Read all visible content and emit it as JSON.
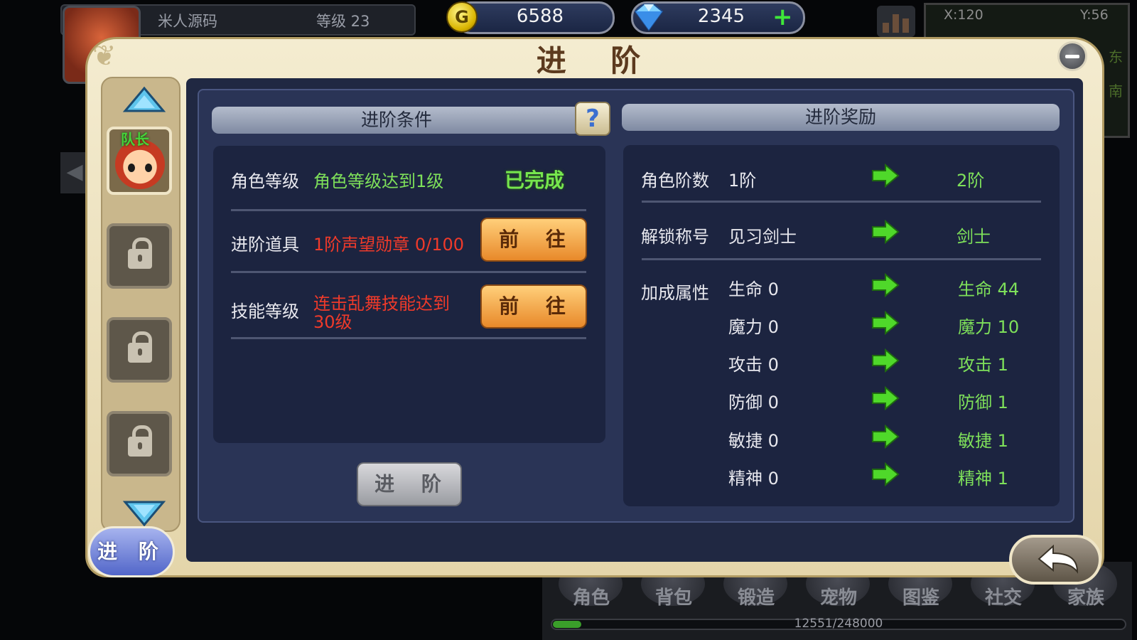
{
  "hud": {
    "player_name": "米人源码",
    "level_text": "等级 23",
    "gold": "6588",
    "gems": "2345",
    "gem_plus": "+",
    "map_x": "X:120",
    "map_y": "Y:56",
    "map_dir_east": "东",
    "map_dir_south": "南"
  },
  "bottom_nav": {
    "items": [
      "角色",
      "背包",
      "锻造",
      "宠物",
      "图鉴",
      "社交",
      "家族"
    ],
    "xp_text": "12551/248000",
    "xp_fraction": 0.05
  },
  "dialog": {
    "title": "进 阶",
    "side_tab_label": "进 阶",
    "leader_label": "队长",
    "conditions_header": "进阶条件",
    "help_label": "?",
    "rewards_header": "进阶奖励",
    "advance_button": "进 阶",
    "conditions": [
      {
        "label": "角色等级",
        "desc": "角色等级达到1级",
        "status": "已完成"
      },
      {
        "label": "进阶道具",
        "desc": "1阶声望勋章  0/100",
        "button": "前 往"
      },
      {
        "label": "技能等级",
        "desc_line1": "连击乱舞技能达到",
        "desc_line2": "30级",
        "button": "前 往"
      }
    ],
    "rewards": {
      "rank": {
        "label": "角色阶数",
        "from": "1阶",
        "to": "2阶"
      },
      "title": {
        "label": "解锁称号",
        "from": "见习剑士",
        "to": "剑士"
      },
      "attrs_label": "加成属性",
      "attrs": [
        {
          "from": "生命 0",
          "to": "生命 44"
        },
        {
          "from": "魔力 0",
          "to": "魔力 10"
        },
        {
          "from": "攻击 0",
          "to": "攻击 1"
        },
        {
          "from": "防御 0",
          "to": "防御 1"
        },
        {
          "from": "敏捷 0",
          "to": "敏捷 1"
        },
        {
          "from": "精神 0",
          "to": "精神 1"
        }
      ]
    }
  },
  "colors": {
    "accent_green": "#7ee05a",
    "warning_red": "#ef3a2a",
    "button_orange": "#e8892a"
  }
}
